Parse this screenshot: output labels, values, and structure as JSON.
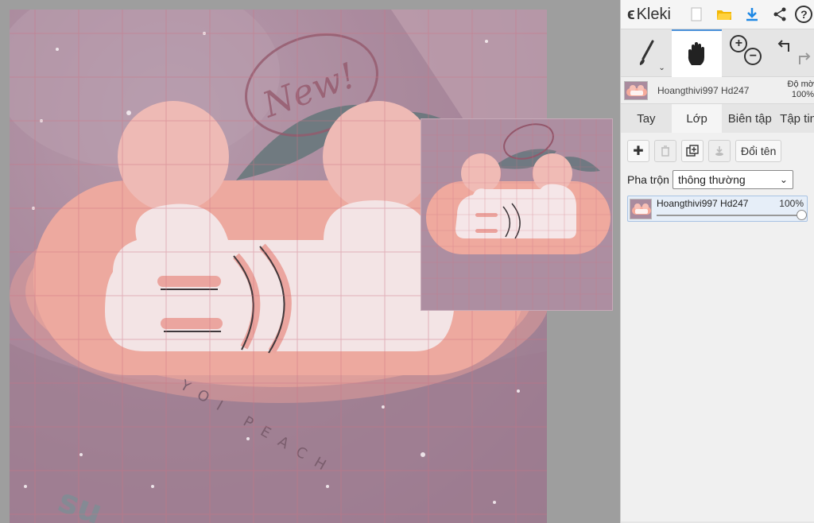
{
  "app": {
    "logo_text": "Kleki"
  },
  "toolbar": {
    "icons": [
      "brush-icon",
      "hand-icon",
      "zoom-in-icon",
      "zoom-out-icon",
      "undo-icon",
      "redo-icon"
    ],
    "top_icons": [
      "new-file-icon",
      "open-folder-icon",
      "download-icon",
      "share-icon",
      "help-icon"
    ]
  },
  "layer_info": {
    "name": "Hoangthivi997 Hd247",
    "opacity_label": "Độ mờ",
    "opacity_value": "100%"
  },
  "tabs": [
    {
      "label": "Tay",
      "active": false
    },
    {
      "label": "Lớp",
      "active": true
    },
    {
      "label": "Biên tập",
      "active": false
    },
    {
      "label": "Tập tin",
      "active": false
    }
  ],
  "layers_panel": {
    "rename_label": "Đổi tên",
    "blend_label": "Pha trộn",
    "blend_value": "thông thường",
    "layers": [
      {
        "name": "Hoangthivi997 Hd247",
        "opacity": "100%",
        "opacity_fraction": 1.0
      }
    ]
  },
  "artwork": {
    "text_new": "New!",
    "text_peach": "YOI PEACH",
    "text_sun": "su"
  },
  "colors": {
    "accent": "#4a90d9",
    "canvas_bg": "#9e9e9e",
    "art_purple": "#a48599",
    "blob_peach": "#f6a898",
    "cloud_white": "#fdf3f1"
  }
}
